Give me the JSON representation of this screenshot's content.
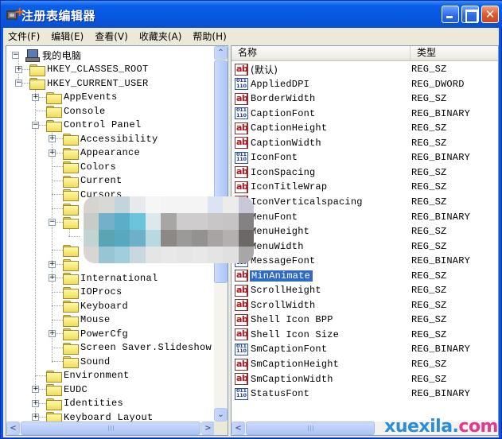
{
  "window": {
    "title": "注册表编辑器",
    "controls": {
      "minimize": "minimize",
      "maximize": "maximize",
      "close": "close"
    }
  },
  "menubar": {
    "items": [
      {
        "label": "文件(F)"
      },
      {
        "label": "编辑(E)"
      },
      {
        "label": "查看(V)"
      },
      {
        "label": "收藏夹(A)"
      },
      {
        "label": "帮助(H)"
      }
    ]
  },
  "tree": {
    "root": {
      "label": "我的电脑",
      "expanded": true,
      "icon": "computer-icon"
    },
    "nodes": [
      {
        "label": "HKEY_CLASSES_ROOT",
        "level": 1,
        "expander": "+"
      },
      {
        "label": "HKEY_CURRENT_USER",
        "level": 1,
        "expander": "-"
      },
      {
        "label": "AppEvents",
        "level": 2,
        "expander": "+"
      },
      {
        "label": "Console",
        "level": 2,
        "expander": ""
      },
      {
        "label": "Control Panel",
        "level": 2,
        "expander": "-"
      },
      {
        "label": "Accessibility",
        "level": 3,
        "expander": "+"
      },
      {
        "label": "Appearance",
        "level": 3,
        "expander": "+"
      },
      {
        "label": "Colors",
        "level": 3,
        "expander": ""
      },
      {
        "label": "Current",
        "level": 3,
        "expander": ""
      },
      {
        "label": "Cursors",
        "level": 3,
        "expander": ""
      },
      {
        "label": "",
        "level": 3,
        "expander": "",
        "obscured": true
      },
      {
        "label": "",
        "level": 3,
        "expander": "-",
        "obscured": true
      },
      {
        "label": "",
        "level": 4,
        "expander": "",
        "obscured": true,
        "no_folder": true
      },
      {
        "label": "",
        "level": 3,
        "expander": "",
        "obscured": true
      },
      {
        "label": "",
        "level": 3,
        "expander": "+",
        "obscured": true
      },
      {
        "label": "International",
        "level": 3,
        "expander": "+"
      },
      {
        "label": "IOProcs",
        "level": 3,
        "expander": ""
      },
      {
        "label": "Keyboard",
        "level": 3,
        "expander": ""
      },
      {
        "label": "Mouse",
        "level": 3,
        "expander": ""
      },
      {
        "label": "PowerCfg",
        "level": 3,
        "expander": "+"
      },
      {
        "label": "Screen Saver.Slideshow",
        "level": 3,
        "expander": ""
      },
      {
        "label": "Sound",
        "level": 3,
        "expander": ""
      },
      {
        "label": "Environment",
        "level": 2,
        "expander": ""
      },
      {
        "label": "EUDC",
        "level": 2,
        "expander": "+"
      },
      {
        "label": "Identities",
        "level": 2,
        "expander": "+"
      },
      {
        "label": "Keyboard Layout",
        "level": 2,
        "expander": "+"
      }
    ],
    "vscroll_position": 0.0,
    "hscroll_position": 0.0
  },
  "list": {
    "columns": {
      "name": "名称",
      "type": "类型"
    },
    "rows": [
      {
        "name": "(默认)",
        "type": "REG_SZ",
        "icon": "string"
      },
      {
        "name": "AppliedDPI",
        "type": "REG_DWORD",
        "icon": "binary"
      },
      {
        "name": "BorderWidth",
        "type": "REG_SZ",
        "icon": "string"
      },
      {
        "name": "CaptionFont",
        "type": "REG_BINARY",
        "icon": "binary"
      },
      {
        "name": "CaptionHeight",
        "type": "REG_SZ",
        "icon": "string"
      },
      {
        "name": "CaptionWidth",
        "type": "REG_SZ",
        "icon": "string"
      },
      {
        "name": "IconFont",
        "type": "REG_BINARY",
        "icon": "binary"
      },
      {
        "name": "IconSpacing",
        "type": "REG_SZ",
        "icon": "string"
      },
      {
        "name": "IconTitleWrap",
        "type": "REG_SZ",
        "icon": "string"
      },
      {
        "name": "IconVerticalspacing",
        "type": "REG_SZ",
        "icon": "string"
      },
      {
        "name": "MenuFont",
        "type": "REG_BINARY",
        "icon": "binary"
      },
      {
        "name": "MenuHeight",
        "type": "REG_SZ",
        "icon": "string"
      },
      {
        "name": "MenuWidth",
        "type": "REG_SZ",
        "icon": "string"
      },
      {
        "name": "MessageFont",
        "type": "REG_BINARY",
        "icon": "binary"
      },
      {
        "name": "MinAnimate",
        "type": "REG_SZ",
        "icon": "string",
        "selected": true
      },
      {
        "name": "ScrollHeight",
        "type": "REG_SZ",
        "icon": "string"
      },
      {
        "name": "ScrollWidth",
        "type": "REG_SZ",
        "icon": "string"
      },
      {
        "name": "Shell Icon BPP",
        "type": "REG_SZ",
        "icon": "string"
      },
      {
        "name": "Shell Icon Size",
        "type": "REG_SZ",
        "icon": "string"
      },
      {
        "name": "SmCaptionFont",
        "type": "REG_BINARY",
        "icon": "binary"
      },
      {
        "name": "SmCaptionHeight",
        "type": "REG_SZ",
        "icon": "string"
      },
      {
        "name": "SmCaptionWidth",
        "type": "REG_SZ",
        "icon": "string"
      },
      {
        "name": "StatusFont",
        "type": "REG_BINARY",
        "icon": "binary"
      }
    ]
  },
  "watermark": {
    "part1": "xuexila.",
    "part2": "com"
  },
  "colors": {
    "titlebar": "#0a5ee8",
    "selection": "#316ac5",
    "menubar": "#ece9d8"
  }
}
